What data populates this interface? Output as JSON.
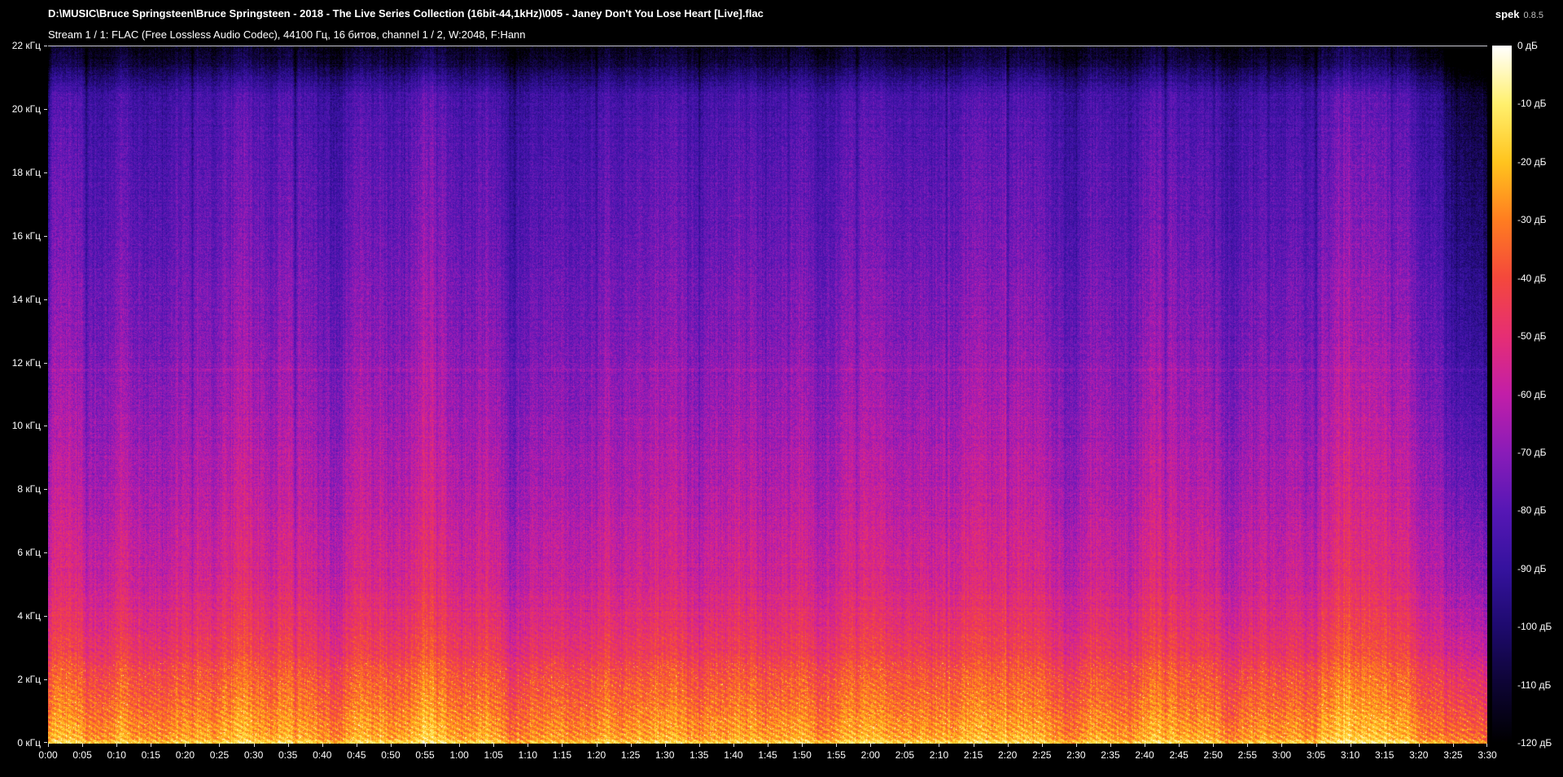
{
  "header": {
    "file_path": "D:\\MUSIC\\Bruce Springsteen\\Bruce Springsteen - 2018 - The Live Series Collection (16bit-44,1kHz)\\005 - Janey Don't You Lose Heart [Live].flac",
    "app_name": "spek",
    "app_version": "0.8.5",
    "stream_info": "Stream 1 / 1: FLAC (Free Lossless Audio Codec), 44100 Гц, 16 битов, channel 1 / 2, W:2048, F:Hann"
  },
  "chart_data": {
    "type": "heatmap",
    "description": "Audio spectrogram: time (x) vs frequency (y), intensity in dB mapped to colour",
    "duration_seconds": 210,
    "x_axis": {
      "unit": "min:sec",
      "range_seconds": [
        0,
        210
      ],
      "tick_interval_seconds": 5,
      "ticks": [
        "0:00",
        "0:05",
        "0:10",
        "0:15",
        "0:20",
        "0:25",
        "0:30",
        "0:35",
        "0:40",
        "0:45",
        "0:50",
        "0:55",
        "1:00",
        "1:05",
        "1:10",
        "1:15",
        "1:20",
        "1:25",
        "1:30",
        "1:35",
        "1:40",
        "1:45",
        "1:50",
        "1:55",
        "2:00",
        "2:05",
        "2:10",
        "2:15",
        "2:20",
        "2:25",
        "2:30",
        "2:35",
        "2:40",
        "2:45",
        "2:50",
        "2:55",
        "3:00",
        "3:05",
        "3:10",
        "3:15",
        "3:20",
        "3:25",
        "3:30"
      ]
    },
    "y_axis": {
      "unit": "кГц",
      "range_khz": [
        0,
        22
      ],
      "tick_interval_khz": 2,
      "ticks": [
        "22 кГц",
        "20 кГц",
        "18 кГц",
        "16 кГц",
        "14 кГц",
        "12 кГц",
        "10 кГц",
        "8 кГц",
        "6 кГц",
        "4 кГц",
        "2 кГц",
        "0 кГц"
      ]
    },
    "legend": {
      "unit": "дБ",
      "range_db": [
        -120,
        0
      ],
      "tick_interval_db": 10,
      "ticks": [
        "0 дБ",
        "-10 дБ",
        "-20 дБ",
        "-30 дБ",
        "-40 дБ",
        "-50 дБ",
        "-60 дБ",
        "-70 дБ",
        "-80 дБ",
        "-90 дБ",
        "-100 дБ",
        "-110 дБ",
        "-120 дБ"
      ]
    },
    "palette": [
      {
        "u": 0.0,
        "color": "#000000"
      },
      {
        "u": 0.083,
        "color": "#0d0433"
      },
      {
        "u": 0.167,
        "color": "#1e0a6e"
      },
      {
        "u": 0.25,
        "color": "#35129e"
      },
      {
        "u": 0.333,
        "color": "#5617b5"
      },
      {
        "u": 0.417,
        "color": "#8a1cb8"
      },
      {
        "u": 0.5,
        "color": "#c21ea8"
      },
      {
        "u": 0.583,
        "color": "#e62e74"
      },
      {
        "u": 0.667,
        "color": "#f4483c"
      },
      {
        "u": 0.75,
        "color": "#ff7d20"
      },
      {
        "u": 0.833,
        "color": "#ffc41e"
      },
      {
        "u": 0.917,
        "color": "#fff06e"
      },
      {
        "u": 1.0,
        "color": "#ffffff"
      }
    ],
    "frequency_profile_db": [
      [
        0,
        -21
      ],
      [
        0.3,
        -25
      ],
      [
        1,
        -31
      ],
      [
        2,
        -37
      ],
      [
        3,
        -45
      ],
      [
        5,
        -54
      ],
      [
        8,
        -61
      ],
      [
        12,
        -69
      ],
      [
        16,
        -76
      ],
      [
        19,
        -81
      ],
      [
        20.5,
        -85
      ],
      [
        21,
        -95
      ],
      [
        21.5,
        -107
      ],
      [
        22,
        -114
      ]
    ]
  }
}
